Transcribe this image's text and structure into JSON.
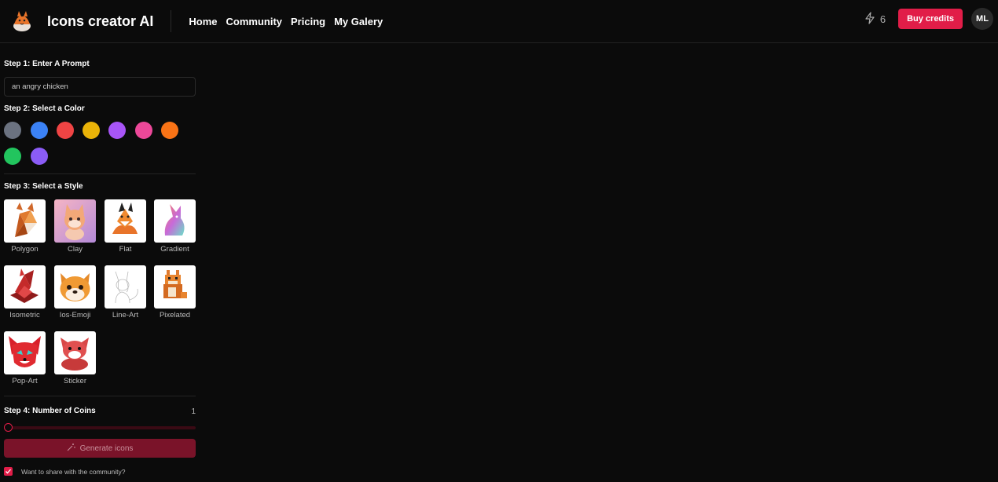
{
  "header": {
    "app_title": "Icons creator AI",
    "nav": [
      "Home",
      "Community",
      "Pricing",
      "My Galery"
    ],
    "credits_count": "6",
    "buy_label": "Buy credits",
    "avatar_initials": "ML"
  },
  "steps": {
    "step1_title": "Step 1: Enter A Prompt",
    "prompt_value": "an angry chicken",
    "step2_title": "Step 2: Select a Color",
    "colors": [
      "#6b7280",
      "#3b82f6",
      "#ef4444",
      "#eab308",
      "#a855f7",
      "#ec4899",
      "#f97316",
      "#22c55e",
      "#8b5cf6"
    ],
    "step3_title": "Step 3: Select a Style",
    "styles": [
      "Polygon",
      "Clay",
      "Flat",
      "Gradient",
      "Isometric",
      "Ios-Emoji",
      "Line-Art",
      "Pixelated",
      "Pop-Art",
      "Sticker"
    ],
    "step4_title": "Step 4: Number of Coins",
    "coins_value": "1",
    "generate_label": "Generate icons",
    "share_label": "Want to share with the community?"
  }
}
